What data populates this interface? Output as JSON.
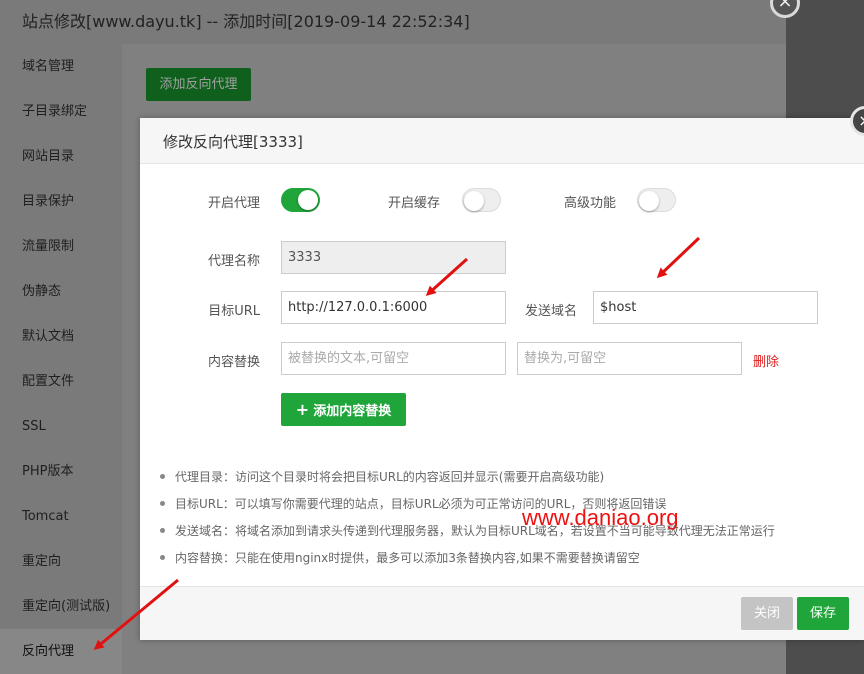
{
  "window": {
    "title": "站点修改[www.dayu.tk] -- 添加时间[2019-09-14 22:52:34]",
    "close_glyph": "×"
  },
  "sidebar": {
    "items": [
      {
        "label": "域名管理"
      },
      {
        "label": "子目录绑定"
      },
      {
        "label": "网站目录"
      },
      {
        "label": "目录保护"
      },
      {
        "label": "流量限制"
      },
      {
        "label": "伪静态"
      },
      {
        "label": "默认文档"
      },
      {
        "label": "配置文件"
      },
      {
        "label": "SSL"
      },
      {
        "label": "PHP版本"
      },
      {
        "label": "Tomcat"
      },
      {
        "label": "重定向"
      },
      {
        "label": "重定向(测试版)"
      },
      {
        "label": "反向代理"
      }
    ],
    "active": "反向代理"
  },
  "background": {
    "add_proxy_label": "添加反向代理"
  },
  "modal": {
    "title": "修改反向代理[3333]",
    "close_glyph": "×",
    "toggles": {
      "enable_proxy": {
        "label": "开启代理",
        "on": true
      },
      "enable_cache": {
        "label": "开启缓存",
        "on": false
      },
      "advanced": {
        "label": "高级功能",
        "on": false
      }
    },
    "proxy_name": {
      "label": "代理名称",
      "value": "3333"
    },
    "target_url": {
      "label": "目标URL",
      "value": "http://127.0.0.1:6000"
    },
    "send_domain": {
      "label": "发送域名",
      "value": "$host"
    },
    "content_replace": {
      "label": "内容替换",
      "from_placeholder": "被替换的文本,可留空",
      "to_placeholder": "替换为,可留空",
      "delete_label": "删除"
    },
    "add_replace_label": "添加内容替换",
    "notes": [
      "代理目录：访问这个目录时将会把目标URL的内容返回并显示(需要开启高级功能)",
      "目标URL：可以填写你需要代理的站点，目标URL必须为可正常访问的URL，否则将返回错误",
      "发送域名：将域名添加到请求头传递到代理服务器，默认为目标URL域名，若设置不当可能导致代理无法正常运行",
      "内容替换：只能在使用nginx时提供，最多可以添加3条替换内容,如果不需要替换请留空"
    ],
    "footer": {
      "close_label": "关闭",
      "save_label": "保存"
    }
  },
  "watermark": "www.daniao.org",
  "colors": {
    "accent_green": "#20a53a",
    "annotation_red": "#e11111",
    "delete_red": "#e02020"
  }
}
